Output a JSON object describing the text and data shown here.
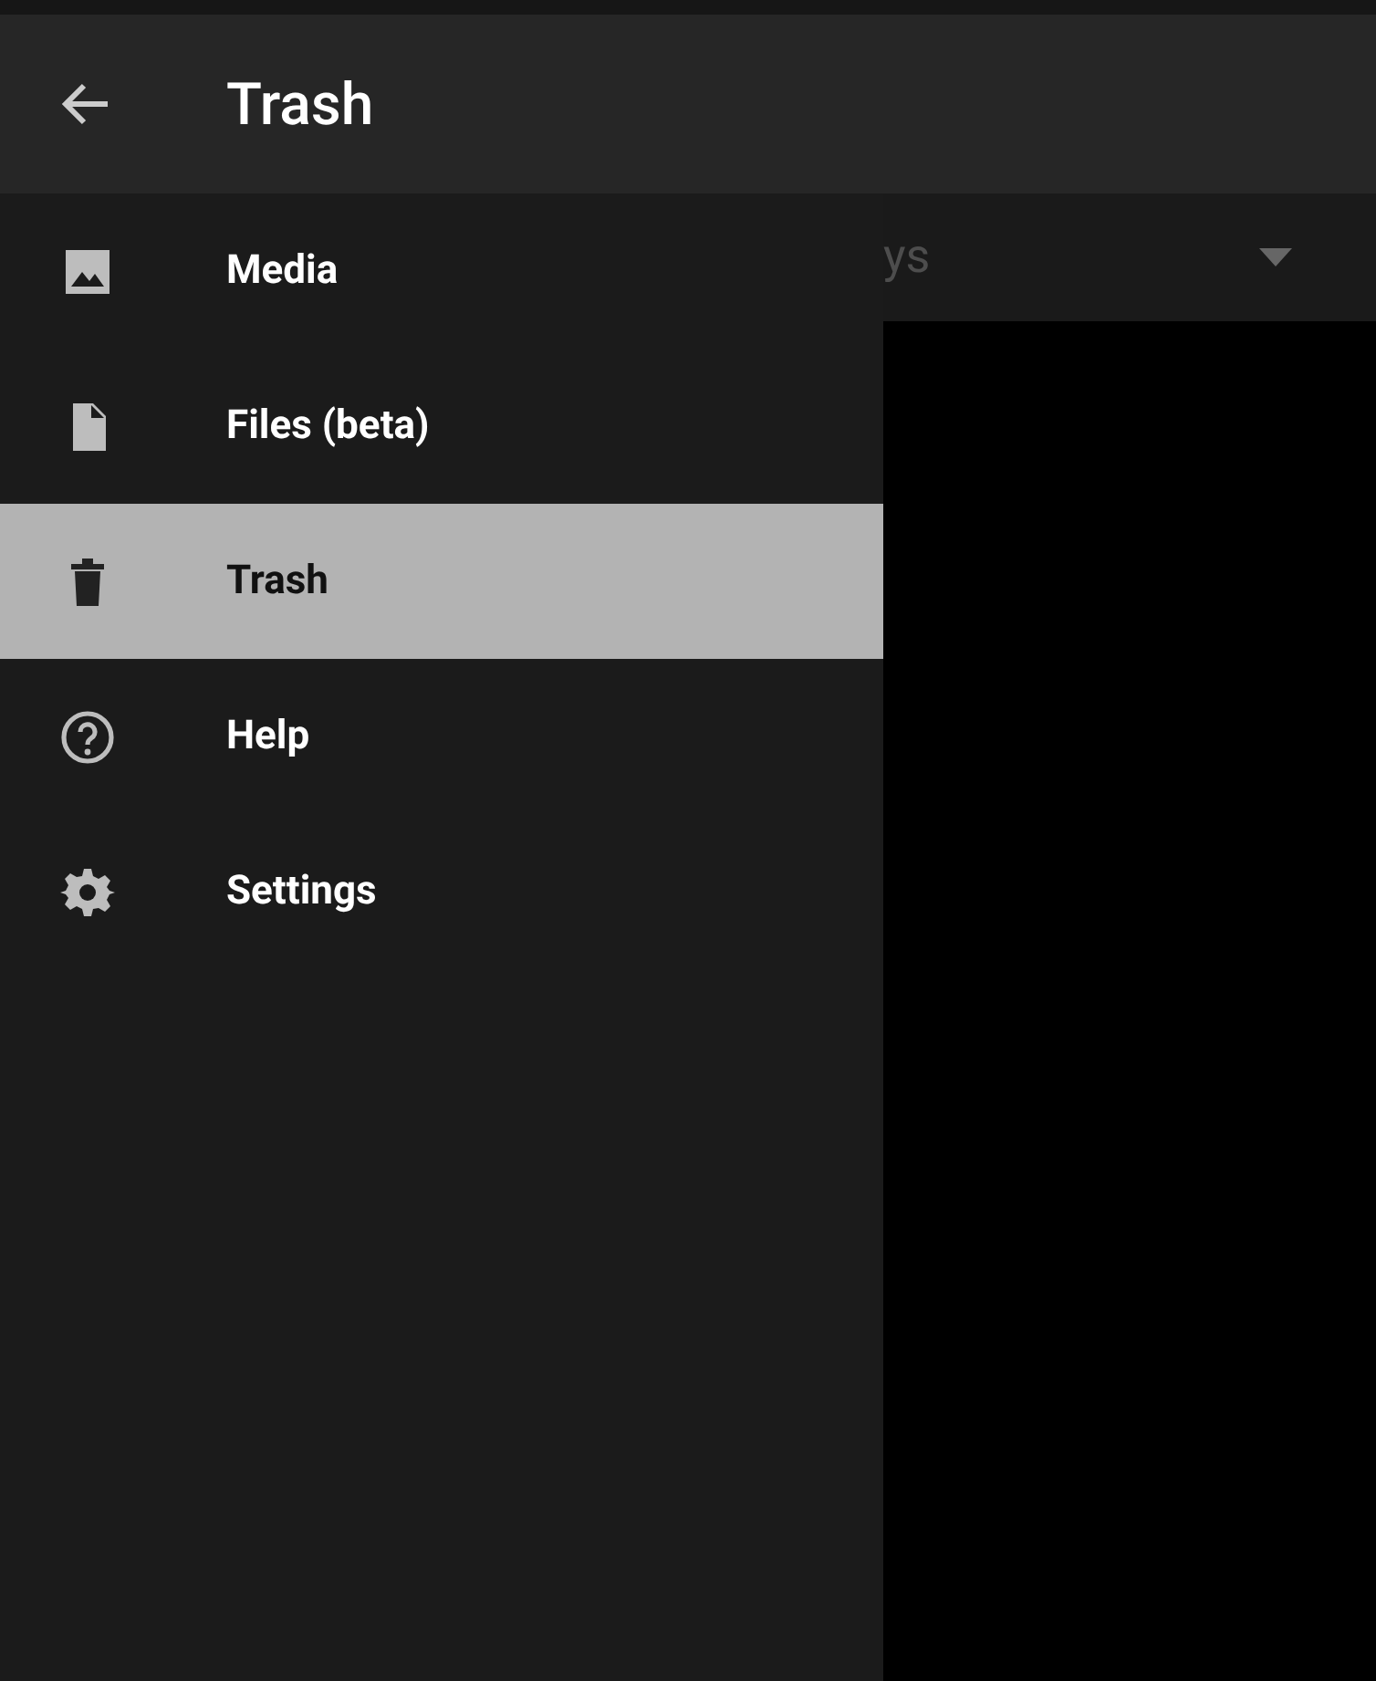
{
  "header": {
    "title": "Trash"
  },
  "behind": {
    "dropdown": {
      "value": "ys"
    }
  },
  "drawer": {
    "items": [
      {
        "label": "Media",
        "kind": "image",
        "selected": false
      },
      {
        "label": "Files (beta)",
        "kind": "file",
        "selected": false
      },
      {
        "label": "Trash",
        "kind": "trash",
        "selected": true
      },
      {
        "label": "Help",
        "kind": "help",
        "selected": false
      },
      {
        "label": "Settings",
        "kind": "settings",
        "selected": false
      }
    ]
  }
}
